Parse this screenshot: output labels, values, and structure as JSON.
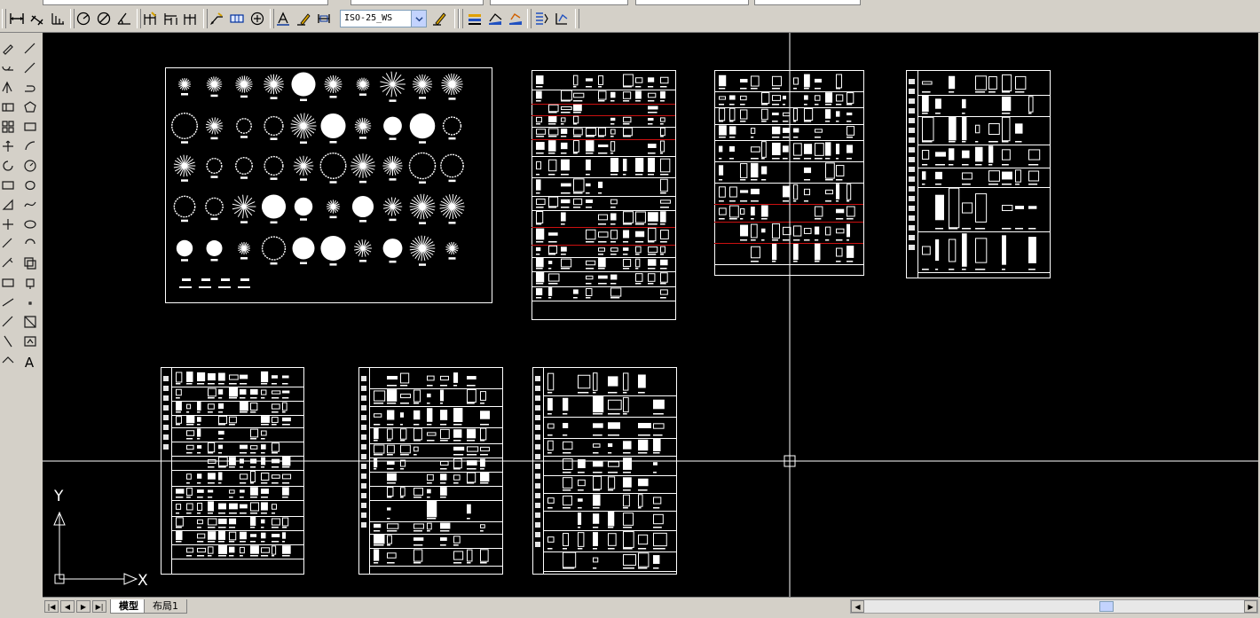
{
  "toolbar": {
    "dimstyle_value": "ISO-25_WS",
    "buttons": [
      "linear-dimension",
      "aligned-dimension",
      "ordinate-dimension",
      "radius-dimension",
      "diameter-dimension",
      "angular-dimension",
      "quick-dimension",
      "baseline-dimension",
      "continue-dimension",
      "quick-leader",
      "tolerance",
      "center-mark",
      "dimension-edit",
      "dimension-text-edit",
      "dimension-update"
    ]
  },
  "left_toolbar": {
    "text_tool_label": "A"
  },
  "ucs": {
    "x_label": "X",
    "y_label": "Y"
  },
  "bottombar": {
    "tabs": [
      {
        "label": "模型",
        "active": true
      },
      {
        "label": "布局1",
        "active": false
      }
    ]
  },
  "colors": {
    "canvas": "#000000",
    "linework": "#ffffff",
    "accent_lines": "#cc1010",
    "chrome": "#d4d0c8"
  }
}
